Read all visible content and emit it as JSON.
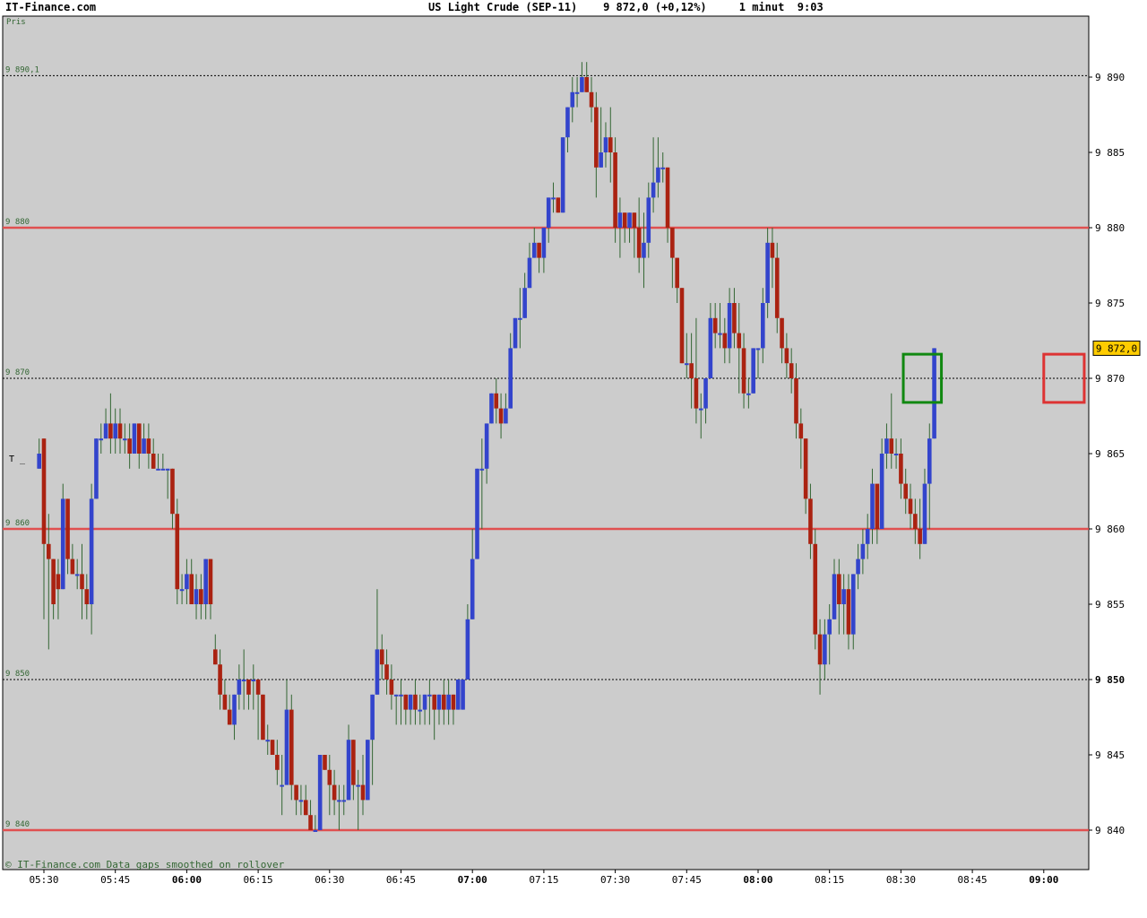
{
  "header": {
    "brand": "IT-Finance.com",
    "title": "US Light Crude (SEP-11)    9 872,0 (+0,12%)     1 minut  9:03"
  },
  "panel": {
    "label": "Pris",
    "footer": "© IT-Finance.com Data gaps smoothed on rollover",
    "marker_label": "T _"
  },
  "colors": {
    "background": "#ffffff",
    "plot_bg": "#cccccc",
    "up_bar": "#3344cc",
    "down_bar": "#aa2211",
    "wick": "#336633",
    "level_line": "#e05050",
    "green_box": "#118811",
    "red_box": "#dd3333",
    "price_tag": "#ffcc00"
  },
  "chart_data": {
    "type": "candlestick",
    "instrument": "US Light Crude (SEP-11)",
    "interval": "1 minut",
    "last": 9872.0,
    "last_label": "9 872,0",
    "change_pct": 0.12,
    "ylim": [
      9837,
      9895
    ],
    "y_ticks": [
      {
        "v": 9890,
        "label": "9 890"
      },
      {
        "v": 9885,
        "label": "9 885"
      },
      {
        "v": 9880,
        "label": "9 880"
      },
      {
        "v": 9875,
        "label": "9 875"
      },
      {
        "v": 9870,
        "label": "9 870"
      },
      {
        "v": 9865,
        "label": "9 865"
      },
      {
        "v": 9860,
        "label": "9 860"
      },
      {
        "v": 9855,
        "label": "9 855"
      },
      {
        "v": 9850,
        "label": "9 850"
      },
      {
        "v": 9845,
        "label": "9 845"
      },
      {
        "v": 9840,
        "label": "9 840"
      }
    ],
    "bold_y_ticks": [
      9850
    ],
    "x_range_minutes": [
      324,
      548
    ],
    "x_ticks": [
      {
        "t": 330,
        "label": "05:30",
        "bold": false
      },
      {
        "t": 345,
        "label": "05:45",
        "bold": false
      },
      {
        "t": 360,
        "label": "06:00",
        "bold": true
      },
      {
        "t": 375,
        "label": "06:15",
        "bold": false
      },
      {
        "t": 390,
        "label": "06:30",
        "bold": false
      },
      {
        "t": 405,
        "label": "06:45",
        "bold": false
      },
      {
        "t": 420,
        "label": "07:00",
        "bold": true
      },
      {
        "t": 435,
        "label": "07:15",
        "bold": false
      },
      {
        "t": 450,
        "label": "07:30",
        "bold": false
      },
      {
        "t": 465,
        "label": "07:45",
        "bold": false
      },
      {
        "t": 480,
        "label": "08:00",
        "bold": true
      },
      {
        "t": 495,
        "label": "08:15",
        "bold": false
      },
      {
        "t": 510,
        "label": "08:30",
        "bold": false
      },
      {
        "t": 525,
        "label": "08:45",
        "bold": false
      },
      {
        "t": 540,
        "label": "09:00",
        "bold": true
      }
    ],
    "level_lines": [
      {
        "v": 9890.1,
        "label": "9 890,1",
        "style": "dotted"
      },
      {
        "v": 9880,
        "label": "9 880",
        "style": "solid"
      },
      {
        "v": 9870,
        "label": "9 870",
        "style": "dotted"
      },
      {
        "v": 9860,
        "label": "9 860",
        "style": "solid"
      },
      {
        "v": 9850,
        "label": "9 850",
        "style": "dotted"
      },
      {
        "v": 9840,
        "label": "9 840",
        "style": "solid"
      }
    ],
    "highlight_boxes": [
      {
        "t0": 510.5,
        "t1": 518.5,
        "v0": 9868.4,
        "v1": 9871.6,
        "color": "green"
      },
      {
        "t0": 540.0,
        "t1": 548.5,
        "v0": 9868.4,
        "v1": 9871.6,
        "color": "red"
      }
    ],
    "ohlc_t0": 329,
    "ohlc": [
      [
        9864,
        9866,
        9864,
        9865
      ],
      [
        9866,
        9866,
        9854,
        9859
      ],
      [
        9859,
        9861,
        9852,
        9858
      ],
      [
        9858,
        9858,
        9854,
        9855
      ],
      [
        9857,
        9858,
        9854,
        9856
      ],
      [
        9856,
        9863,
        9856,
        9862
      ],
      [
        9862,
        9862,
        9857,
        9858
      ],
      [
        9858,
        9859,
        9857,
        9857
      ],
      [
        9857,
        9858,
        9856,
        9857
      ],
      [
        9857,
        9859,
        9854,
        9856
      ],
      [
        9856,
        9857,
        9854,
        9855
      ],
      [
        9855,
        9863,
        9853,
        9862
      ],
      [
        9862,
        9866,
        9862,
        9866
      ],
      [
        9866,
        9867,
        9865,
        9866
      ],
      [
        9866,
        9868,
        9866,
        9867
      ],
      [
        9867,
        9869,
        9865,
        9866
      ],
      [
        9866,
        9868,
        9865,
        9867
      ],
      [
        9867,
        9868,
        9865,
        9866
      ],
      [
        9866,
        9867,
        9865,
        9866
      ],
      [
        9866,
        9867,
        9864,
        9865
      ],
      [
        9865,
        9867,
        9865,
        9867
      ],
      [
        9867,
        9867,
        9864,
        9865
      ],
      [
        9865,
        9867,
        9865,
        9866
      ],
      [
        9866,
        9867,
        9864,
        9865
      ],
      [
        9865,
        9866,
        9864,
        9864
      ],
      [
        9864,
        9865,
        9864,
        9864
      ],
      [
        9864,
        9865,
        9864,
        9864
      ],
      [
        9864,
        9864,
        9862,
        9864
      ],
      [
        9864,
        9864,
        9860,
        9861
      ],
      [
        9861,
        9862,
        9855,
        9856
      ],
      [
        9856,
        9857,
        9855,
        9856
      ],
      [
        9856,
        9858,
        9855,
        9857
      ],
      [
        9857,
        9858,
        9855,
        9855
      ],
      [
        9855,
        9857,
        9854,
        9856
      ],
      [
        9856,
        9857,
        9854,
        9855
      ],
      [
        9855,
        9858,
        9854,
        9858
      ],
      [
        9858,
        9858,
        9854,
        9855
      ],
      [
        9852,
        9853,
        9851,
        9851
      ],
      [
        9851,
        9852,
        9848,
        9849
      ],
      [
        9849,
        9850,
        9848,
        9848
      ],
      [
        9848,
        9849,
        9847,
        9847
      ],
      [
        9847,
        9849,
        9846,
        9849
      ],
      [
        9849,
        9851,
        9848,
        9850
      ],
      [
        9850,
        9852,
        9848,
        9850
      ],
      [
        9850,
        9850,
        9848,
        9849
      ],
      [
        9850,
        9851,
        9848,
        9850
      ],
      [
        9850,
        9850,
        9846,
        9849
      ],
      [
        9849,
        9849,
        9846,
        9846
      ],
      [
        9846,
        9847,
        9845,
        9846
      ],
      [
        9846,
        9846,
        9845,
        9845
      ],
      [
        9845,
        9846,
        9843,
        9844
      ],
      [
        9843,
        9845,
        9841,
        9843
      ],
      [
        9843,
        9850,
        9843,
        9848
      ],
      [
        9848,
        9849,
        9842,
        9843
      ],
      [
        9843,
        9843,
        9841,
        9842
      ],
      [
        9842,
        9843,
        9841,
        9842
      ],
      [
        9842,
        9843,
        9841,
        9841
      ],
      [
        9841,
        9842,
        9840,
        9840
      ],
      [
        9840,
        9841,
        9840,
        9840
      ],
      [
        9840,
        9845,
        9840,
        9845
      ],
      [
        9845,
        9845,
        9844,
        9844
      ],
      [
        9844,
        9845,
        9841,
        9843
      ],
      [
        9843,
        9844,
        9841,
        9842
      ],
      [
        9842,
        9843,
        9840,
        9842
      ],
      [
        9842,
        9843,
        9841,
        9842
      ],
      [
        9842,
        9847,
        9842,
        9846
      ],
      [
        9846,
        9846,
        9842,
        9843
      ],
      [
        9843,
        9844,
        9840,
        9843
      ],
      [
        9843,
        9845,
        9841,
        9842
      ],
      [
        9842,
        9846,
        9842,
        9846
      ],
      [
        9846,
        9849,
        9843,
        9849
      ],
      [
        9849,
        9856,
        9849,
        9852
      ],
      [
        9852,
        9853,
        9850,
        9851
      ],
      [
        9851,
        9852,
        9849,
        9850
      ],
      [
        9850,
        9851,
        9848,
        9849
      ],
      [
        9849,
        9849,
        9847,
        9849
      ],
      [
        9849,
        9850,
        9847,
        9849
      ],
      [
        9849,
        9849,
        9847,
        9848
      ],
      [
        9848,
        9849,
        9847,
        9849
      ],
      [
        9849,
        9850,
        9847,
        9848
      ],
      [
        9848,
        9849,
        9847,
        9848
      ],
      [
        9848,
        9849,
        9847,
        9849
      ],
      [
        9849,
        9850,
        9847,
        9849
      ],
      [
        9849,
        9849,
        9846,
        9848
      ],
      [
        9848,
        9849,
        9847,
        9849
      ],
      [
        9849,
        9850,
        9847,
        9848
      ],
      [
        9848,
        9850,
        9847,
        9849
      ],
      [
        9849,
        9849,
        9847,
        9848
      ],
      [
        9848,
        9850,
        9848,
        9850
      ],
      [
        9848,
        9850,
        9848,
        9850
      ],
      [
        9850,
        9855,
        9850,
        9854
      ],
      [
        9854,
        9860,
        9854,
        9858
      ],
      [
        9858,
        9864,
        9858,
        9864
      ],
      [
        9864,
        9866,
        9860,
        9864
      ],
      [
        9864,
        9867,
        9863,
        9867
      ],
      [
        9867,
        9869,
        9867,
        9869
      ],
      [
        9869,
        9870,
        9867,
        9868
      ],
      [
        9868,
        9869,
        9866,
        9867
      ],
      [
        9867,
        9869,
        9867,
        9868
      ],
      [
        9868,
        9873,
        9868,
        9872
      ],
      [
        9872,
        9874,
        9872,
        9874
      ],
      [
        9874,
        9876,
        9872,
        9874
      ],
      [
        9874,
        9877,
        9874,
        9876
      ],
      [
        9876,
        9879,
        9876,
        9878
      ],
      [
        9878,
        9880,
        9878,
        9879
      ],
      [
        9879,
        9879,
        9877,
        9878
      ],
      [
        9878,
        9880,
        9877,
        9880
      ],
      [
        9880,
        9882,
        9879,
        9882
      ],
      [
        9882,
        9883,
        9881,
        9882
      ],
      [
        9882,
        9882,
        9881,
        9881
      ],
      [
        9881,
        9886,
        9881,
        9886
      ],
      [
        9886,
        9888,
        9885,
        9888
      ],
      [
        9888,
        9890,
        9887,
        9889
      ],
      [
        9889,
        9890,
        9888,
        9889
      ],
      [
        9889,
        9891,
        9889,
        9890
      ],
      [
        9890,
        9891,
        9889,
        9889
      ],
      [
        9889,
        9890,
        9887,
        9888
      ],
      [
        9888,
        9889,
        9882,
        9884
      ],
      [
        9884,
        9888,
        9884,
        9885
      ],
      [
        9885,
        9887,
        9884,
        9886
      ],
      [
        9886,
        9888,
        9883,
        9885
      ],
      [
        9885,
        9886,
        9879,
        9880
      ],
      [
        9880,
        9882,
        9878,
        9881
      ],
      [
        9881,
        9881,
        9879,
        9880
      ],
      [
        9880,
        9881,
        9879,
        9881
      ],
      [
        9881,
        9881,
        9878,
        9880
      ],
      [
        9880,
        9882,
        9877,
        9878
      ],
      [
        9878,
        9881,
        9876,
        9879
      ],
      [
        9879,
        9883,
        9878,
        9882
      ],
      [
        9882,
        9886,
        9881,
        9883
      ],
      [
        9883,
        9886,
        9882,
        9884
      ],
      [
        9884,
        9885,
        9883,
        9884
      ],
      [
        9884,
        9884,
        9879,
        9880
      ],
      [
        9880,
        9880,
        9876,
        9878
      ],
      [
        9878,
        9878,
        9875,
        9876
      ],
      [
        9876,
        9876,
        9871,
        9871
      ],
      [
        9871,
        9873,
        9870,
        9871
      ],
      [
        9871,
        9873,
        9868,
        9870
      ],
      [
        9870,
        9874,
        9867,
        9868
      ],
      [
        9868,
        9869,
        9866,
        9868
      ],
      [
        9868,
        9870,
        9867,
        9870
      ],
      [
        9870,
        9875,
        9870,
        9874
      ],
      [
        9874,
        9875,
        9872,
        9873
      ],
      [
        9873,
        9875,
        9872,
        9873
      ],
      [
        9873,
        9874,
        9871,
        9872
      ],
      [
        9872,
        9876,
        9871,
        9875
      ],
      [
        9875,
        9876,
        9872,
        9873
      ],
      [
        9873,
        9875,
        9869,
        9872
      ],
      [
        9872,
        9873,
        9868,
        9869
      ],
      [
        9869,
        9870,
        9868,
        9869
      ],
      [
        9869,
        9872,
        9869,
        9872
      ],
      [
        9872,
        9872,
        9870,
        9872
      ],
      [
        9872,
        9876,
        9871,
        9875
      ],
      [
        9875,
        9880,
        9874,
        9879
      ],
      [
        9879,
        9880,
        9876,
        9878
      ],
      [
        9878,
        9879,
        9873,
        9874
      ],
      [
        9874,
        9874,
        9871,
        9872
      ],
      [
        9872,
        9873,
        9870,
        9871
      ],
      [
        9871,
        9872,
        9869,
        9870
      ],
      [
        9870,
        9871,
        9866,
        9867
      ],
      [
        9867,
        9868,
        9864,
        9866
      ],
      [
        9866,
        9866,
        9861,
        9862
      ],
      [
        9862,
        9863,
        9858,
        9859
      ],
      [
        9859,
        9860,
        9852,
        9853
      ],
      [
        9853,
        9854,
        9849,
        9851
      ],
      [
        9851,
        9854,
        9850,
        9853
      ],
      [
        9853,
        9855,
        9851,
        9854
      ],
      [
        9854,
        9858,
        9854,
        9857
      ],
      [
        9857,
        9858,
        9853,
        9855
      ],
      [
        9855,
        9857,
        9853,
        9856
      ],
      [
        9856,
        9857,
        9852,
        9853
      ],
      [
        9853,
        9857,
        9852,
        9857
      ],
      [
        9857,
        9859,
        9856,
        9858
      ],
      [
        9858,
        9860,
        9857,
        9859
      ],
      [
        9859,
        9861,
        9858,
        9860
      ],
      [
        9860,
        9864,
        9859,
        9863
      ],
      [
        9863,
        9862,
        9859,
        9860
      ],
      [
        9860,
        9866,
        9860,
        9865
      ],
      [
        9865,
        9867,
        9864,
        9866
      ],
      [
        9866,
        9869,
        9864,
        9865
      ],
      [
        9865,
        9866,
        9864,
        9865
      ],
      [
        9865,
        9866,
        9862,
        9863
      ],
      [
        9863,
        9864,
        9861,
        9862
      ],
      [
        9862,
        9863,
        9860,
        9861
      ],
      [
        9861,
        9862,
        9859,
        9860
      ],
      [
        9860,
        9862,
        9858,
        9859
      ],
      [
        9859,
        9864,
        9859,
        9863
      ],
      [
        9863,
        9867,
        9860,
        9866
      ],
      [
        9866,
        9872,
        9866,
        9872
      ]
    ]
  }
}
